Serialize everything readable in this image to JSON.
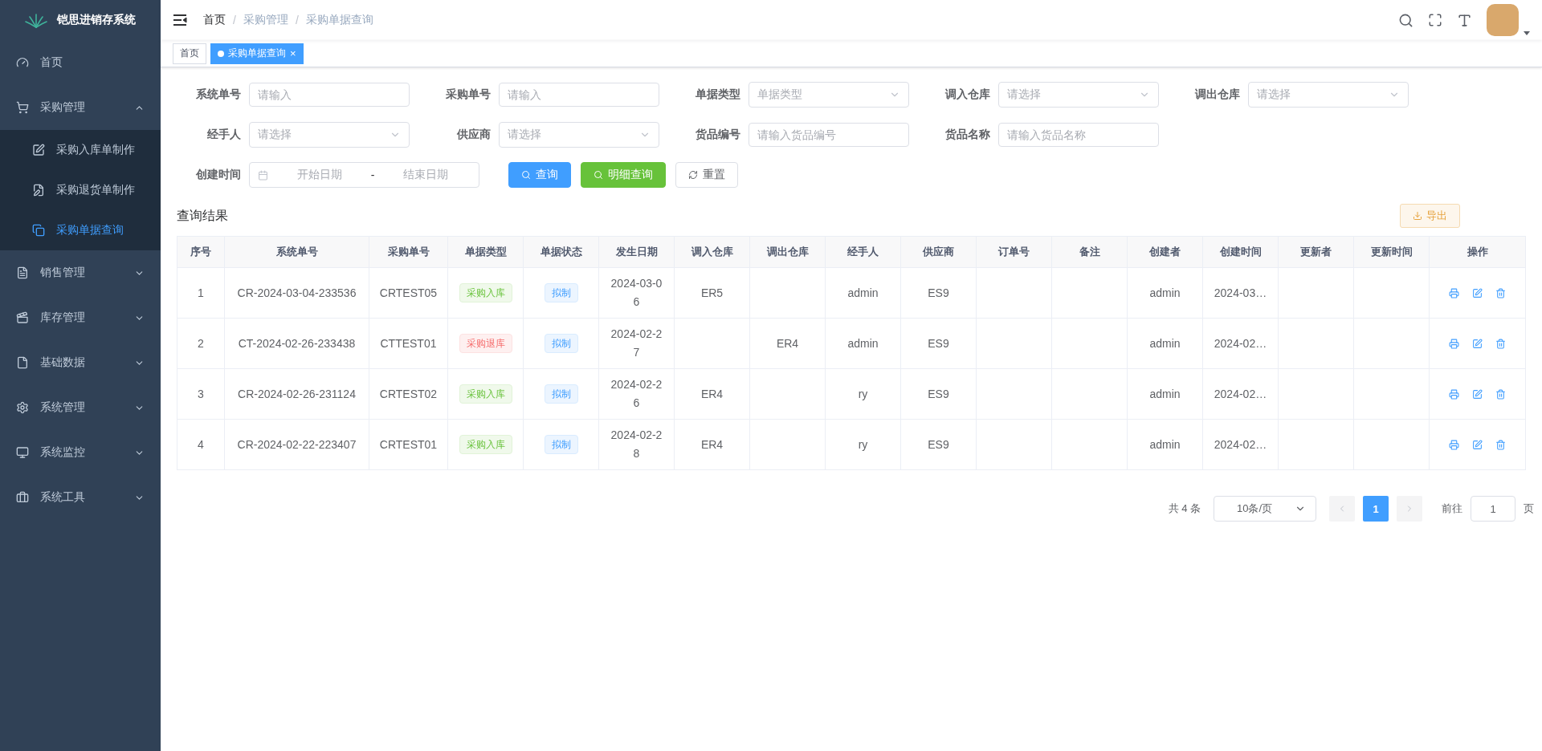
{
  "app": {
    "title": "铠思进销存系统"
  },
  "sidebar": {
    "items": [
      {
        "label": "首页"
      },
      {
        "label": "采购管理",
        "expanded": true,
        "children": [
          {
            "label": "采购入库单制作",
            "selected": false
          },
          {
            "label": "采购退货单制作",
            "selected": false
          },
          {
            "label": "采购单据查询",
            "selected": true
          }
        ]
      },
      {
        "label": "销售管理",
        "expanded": false
      },
      {
        "label": "库存管理",
        "expanded": false
      },
      {
        "label": "基础数据",
        "expanded": false
      },
      {
        "label": "系统管理",
        "expanded": false
      },
      {
        "label": "系统监控",
        "expanded": false
      },
      {
        "label": "系统工具",
        "expanded": false
      }
    ]
  },
  "breadcrumb": {
    "separator": "/",
    "items": [
      "首页",
      "采购管理",
      "采购单据查询"
    ]
  },
  "tags": [
    {
      "label": "首页",
      "selected": false
    },
    {
      "label": "采购单据查询",
      "selected": true,
      "close": "×"
    }
  ],
  "form": {
    "rows": [
      [
        {
          "label": "系统单号",
          "kind": "input",
          "placeholder": "请输入"
        },
        {
          "label": "采购单号",
          "kind": "input",
          "placeholder": "请输入"
        },
        {
          "label": "单据类型",
          "kind": "select",
          "placeholder": "单据类型"
        },
        {
          "label": "调入仓库",
          "kind": "select",
          "placeholder": "请选择"
        },
        {
          "label": "调出仓库",
          "kind": "select",
          "placeholder": "请选择"
        }
      ],
      [
        {
          "label": "经手人",
          "kind": "select",
          "placeholder": "请选择"
        },
        {
          "label": "供应商",
          "kind": "select",
          "placeholder": "请选择"
        },
        {
          "label": "货品编号",
          "kind": "input",
          "placeholder": "请输入货品编号"
        },
        {
          "label": "货品名称",
          "kind": "input",
          "placeholder": "请输入货品名称"
        }
      ],
      [
        {
          "label": "创建时间",
          "kind": "daterange",
          "start_placeholder": "开始日期",
          "separator": "-",
          "end_placeholder": "结束日期"
        }
      ]
    ],
    "buttons": [
      {
        "label": "查询",
        "kind": "primary"
      },
      {
        "label": "明细查询",
        "kind": "success"
      },
      {
        "label": "重置",
        "kind": "default"
      }
    ]
  },
  "results": {
    "title": "查询结果",
    "export_label": "导出",
    "columns": [
      "序号",
      "系统单号",
      "采购单号",
      "单据类型",
      "单据状态",
      "发生日期",
      "调入仓库",
      "调出仓库",
      "经手人",
      "供应商",
      "订单号",
      "备注",
      "创建者",
      "创建时间",
      "更新者",
      "更新时间",
      "操作"
    ],
    "rows": [
      {
        "cells": [
          "1",
          "CR-2024-03-04-233536",
          "CRTEST05",
          {
            "label": "采购入库",
            "kind": "success"
          },
          {
            "label": "拟制",
            "kind": "info"
          },
          "2024-03-06",
          "ER5",
          null,
          "admin",
          "ES9",
          null,
          null,
          "admin",
          "2024-03…",
          null,
          null
        ]
      },
      {
        "cells": [
          "2",
          "CT-2024-02-26-233438",
          "CTTEST01",
          {
            "label": "采购退库",
            "kind": "danger"
          },
          {
            "label": "拟制",
            "kind": "info"
          },
          "2024-02-27",
          null,
          "ER4",
          "admin",
          "ES9",
          null,
          null,
          "admin",
          "2024-02…",
          null,
          null
        ]
      },
      {
        "cells": [
          "3",
          "CR-2024-02-26-231124",
          "CRTEST02",
          {
            "label": "采购入库",
            "kind": "success"
          },
          {
            "label": "拟制",
            "kind": "info"
          },
          "2024-02-26",
          "ER4",
          null,
          "ry",
          "ES9",
          null,
          null,
          "admin",
          "2024-02…",
          null,
          null
        ]
      },
      {
        "cells": [
          "4",
          "CR-2024-02-22-223407",
          "CRTEST01",
          {
            "label": "采购入库",
            "kind": "success"
          },
          {
            "label": "拟制",
            "kind": "info"
          },
          "2024-02-28",
          "ER4",
          null,
          "ry",
          "ES9",
          null,
          null,
          "admin",
          "2024-02…",
          null,
          null
        ]
      }
    ]
  },
  "pagination": {
    "total": "共 4 条",
    "page_size": "10条/页",
    "pages": [
      {
        "label": "1",
        "selected": true
      }
    ],
    "goto_label": "前往",
    "goto_value": "1",
    "page_suffix": "页"
  }
}
